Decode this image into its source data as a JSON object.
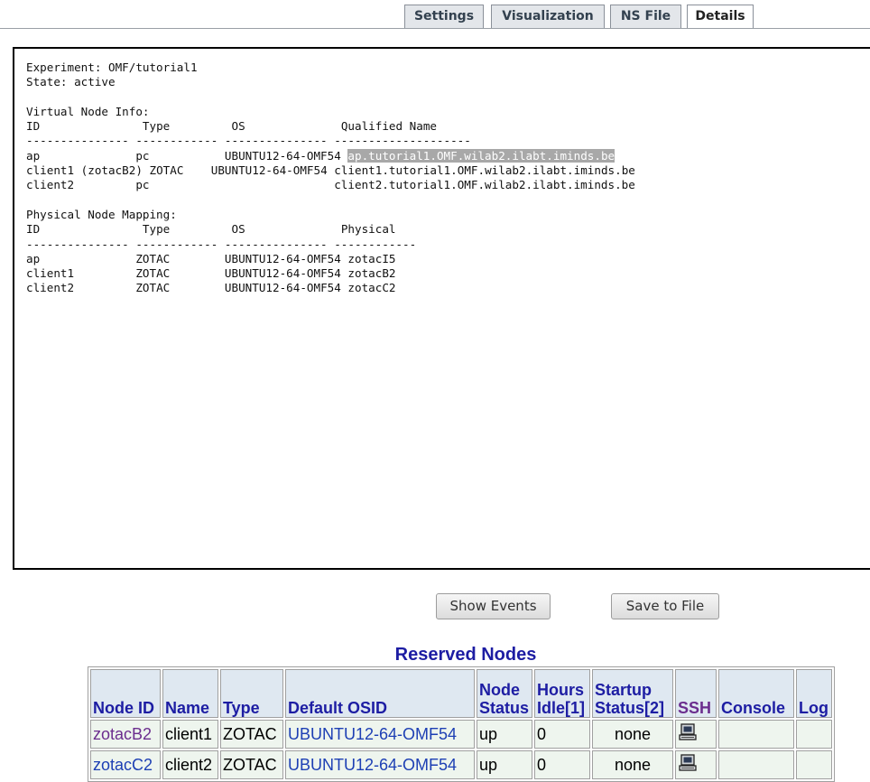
{
  "tabs": [
    {
      "label": "Settings"
    },
    {
      "label": "Visualization"
    },
    {
      "label": "NS File"
    },
    {
      "label": "Details"
    }
  ],
  "details": {
    "experiment_line": "Experiment: OMF/tutorial1",
    "state_line": "State: active",
    "virtual_heading": "Virtual Node Info:",
    "virtual_columns": [
      "ID",
      "Type",
      "OS",
      "Qualified Name"
    ],
    "virtual_separator": "--------------- ------------ --------------- --------------------",
    "virtual_rows": [
      {
        "id": "ap",
        "type": "pc",
        "os": "UBUNTU12-64-OMF54",
        "qualified": "ap.tutorial1.OMF.wilab2.ilabt.iminds.be"
      },
      {
        "id": "client1 (zotacB2)",
        "type": "ZOTAC",
        "os": "UBUNTU12-64-OMF54",
        "qualified": "client1.tutorial1.OMF.wilab2.ilabt.iminds.be"
      },
      {
        "id": "client2",
        "type": "pc",
        "os": "",
        "qualified": "client2.tutorial1.OMF.wilab2.ilabt.iminds.be"
      }
    ],
    "physical_heading": "Physical Node Mapping:",
    "physical_columns": [
      "ID",
      "Type",
      "OS",
      "Physical"
    ],
    "physical_separator": "--------------- ------------ --------------- ------------",
    "physical_rows": [
      {
        "id": "ap",
        "type": "ZOTAC",
        "os": "UBUNTU12-64-OMF54",
        "physical": "zotacI5"
      },
      {
        "id": "client1",
        "type": "ZOTAC",
        "os": "UBUNTU12-64-OMF54",
        "physical": "zotacB2"
      },
      {
        "id": "client2",
        "type": "ZOTAC",
        "os": "UBUNTU12-64-OMF54",
        "physical": "zotacC2"
      }
    ]
  },
  "buttons": {
    "show_events": "Show Events",
    "save_to_file": "Save to File"
  },
  "reserved_nodes": {
    "title": "Reserved Nodes",
    "headers": {
      "node_id": "Node ID",
      "name": "Name",
      "type": "Type",
      "default_osid": "Default OSID",
      "node_status_1": "Node",
      "node_status_2": "Status",
      "hours_idle_1": "Hours",
      "hours_idle_2": "Idle[1]",
      "startup_status_1": "Startup",
      "startup_status_2": "Status[2]",
      "ssh": "SSH",
      "console": "Console",
      "log": "Log"
    },
    "rows": [
      {
        "node_id": "zotacB2",
        "name": "client1",
        "type": "ZOTAC",
        "default_osid": "UBUNTU12-64-OMF54",
        "node_status": "up",
        "hours_idle": "0",
        "startup_status": "none",
        "ssh_icon": "computer-icon",
        "console": "",
        "log": ""
      },
      {
        "node_id": "zotacC2",
        "name": "client2",
        "type": "ZOTAC",
        "default_osid": "UBUNTU12-64-OMF54",
        "node_status": "up",
        "hours_idle": "0",
        "startup_status": "none",
        "ssh_icon": "computer-icon",
        "console": "",
        "log": ""
      }
    ]
  },
  "colors": {
    "link_blue": "#1d3fb4",
    "link_visited": "#6b2d8e",
    "header_text": "#1d1da3",
    "header_bg": "#dfe8f1",
    "cell_bg": "#eef5ee",
    "highlight_bg": "#a8a8a8"
  }
}
